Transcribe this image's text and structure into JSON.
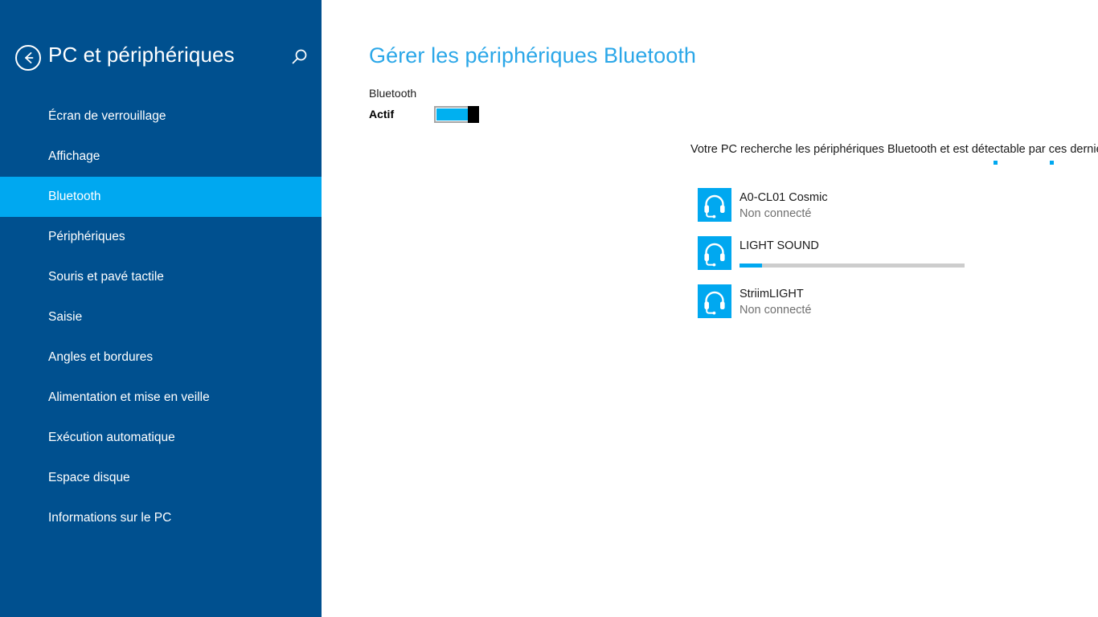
{
  "sidebar": {
    "back_icon": "back-arrow-icon",
    "title": "PC et périphériques",
    "search_icon": "search-icon",
    "items": [
      {
        "label": "Écran de verrouillage",
        "selected": false
      },
      {
        "label": "Affichage",
        "selected": false
      },
      {
        "label": "Bluetooth",
        "selected": true
      },
      {
        "label": "Périphériques",
        "selected": false
      },
      {
        "label": "Souris et pavé tactile",
        "selected": false
      },
      {
        "label": "Saisie",
        "selected": false
      },
      {
        "label": "Angles et bordures",
        "selected": false
      },
      {
        "label": "Alimentation et mise en veille",
        "selected": false
      },
      {
        "label": "Exécution automatique",
        "selected": false
      },
      {
        "label": "Espace disque",
        "selected": false
      },
      {
        "label": "Informations sur le PC",
        "selected": false
      }
    ]
  },
  "main": {
    "title": "Gérer les périphériques Bluetooth",
    "toggle": {
      "caption": "Bluetooth",
      "state_label": "Actif",
      "on": true
    },
    "status_text": "Votre PC recherche les périphériques Bluetooth et est détectable par ces derniers.",
    "devices": [
      {
        "icon": "headset-icon",
        "name": "A0-CL01 Cosmic",
        "status": "Non connecté",
        "progress": null
      },
      {
        "icon": "headset-icon",
        "name": "LIGHT SOUND",
        "status": "",
        "progress": 10
      },
      {
        "icon": "headset-icon",
        "name": "StriimLIGHT",
        "status": "Non connecté",
        "progress": null
      }
    ]
  },
  "colors": {
    "sidebar_bg": "#00508f",
    "accent": "#00a8f0",
    "title_blue": "#2ba7e8",
    "content_bg": "#ffffff",
    "status_gray": "#707070"
  }
}
